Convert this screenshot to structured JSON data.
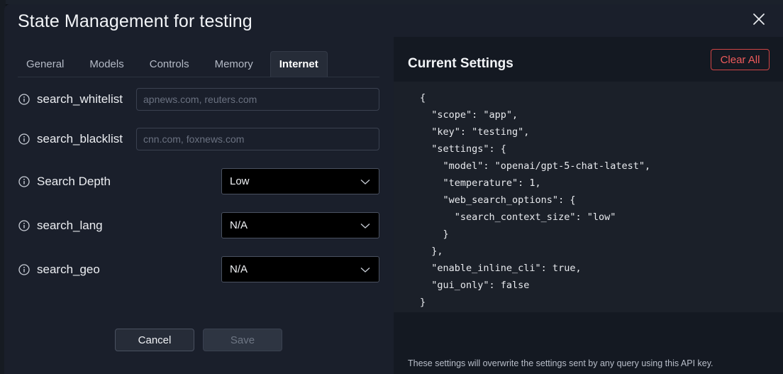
{
  "modal": {
    "title": "State Management for testing"
  },
  "tabs": [
    {
      "label": "General",
      "active": false
    },
    {
      "label": "Models",
      "active": false
    },
    {
      "label": "Controls",
      "active": false
    },
    {
      "label": "Memory",
      "active": false
    },
    {
      "label": "Internet",
      "active": true
    }
  ],
  "fields": {
    "search_whitelist": {
      "label": "search_whitelist",
      "value": "",
      "placeholder": "apnews.com, reuters.com"
    },
    "search_blacklist": {
      "label": "search_blacklist",
      "value": "",
      "placeholder": "cnn.com, foxnews.com"
    },
    "search_depth": {
      "label": "Search Depth",
      "selected": "Low"
    },
    "search_lang": {
      "label": "search_lang",
      "selected": "N/A"
    },
    "search_geo": {
      "label": "search_geo",
      "selected": "N/A"
    }
  },
  "buttons": {
    "cancel": "Cancel",
    "save": "Save"
  },
  "panel": {
    "title": "Current Settings",
    "clear_all": "Clear All",
    "json_text": "{\n  \"scope\": \"app\",\n  \"key\": \"testing\",\n  \"settings\": {\n    \"model\": \"openai/gpt-5-chat-latest\",\n    \"temperature\": 1,\n    \"web_search_options\": {\n      \"search_context_size\": \"low\"\n    }\n  },\n  \"enable_inline_cli\": true,\n  \"gui_only\": false\n}",
    "footnote": "These settings will overwrite the settings sent by any query using this API key."
  },
  "colors": {
    "modal_bg": "#1a1f2b",
    "panel_bg": "#141922",
    "danger": "#ef5b5b"
  },
  "icons": {
    "close": "close-icon",
    "info": "info-icon",
    "chevron": "chevron-down-icon"
  }
}
